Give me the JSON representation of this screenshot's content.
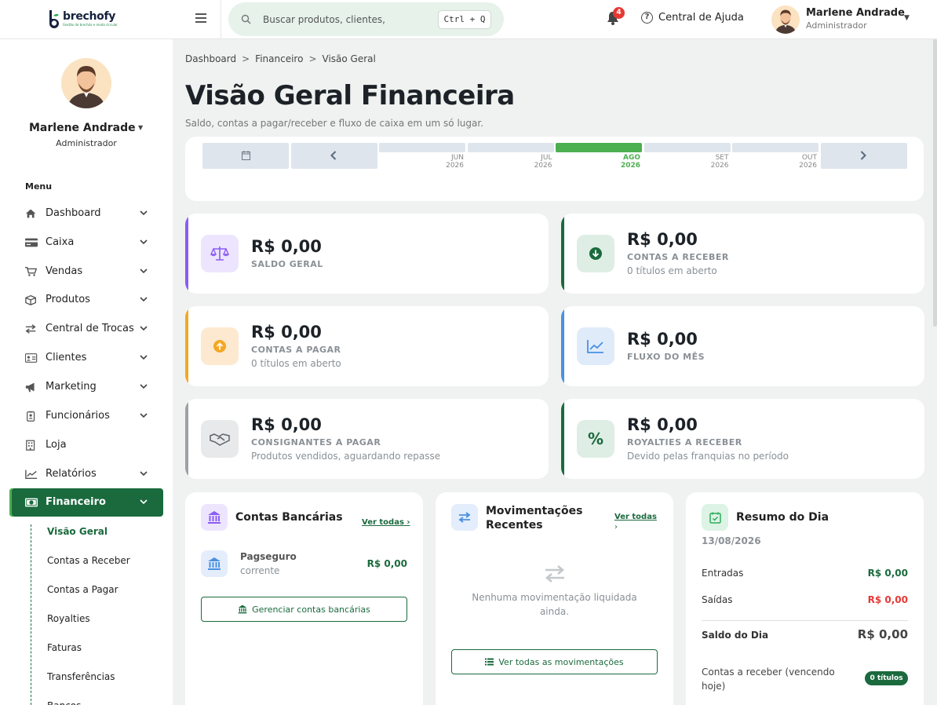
{
  "brand": {
    "name": "brechofy",
    "tagline": "Gestão de brechós e moda circular"
  },
  "header": {
    "search_placeholder": "Buscar produtos, clientes,",
    "search_shortcut": "Ctrl + Q",
    "notification_count": "4",
    "help_label": "Central de Ajuda",
    "user_name": "Marlene Andrade",
    "user_role": "Administrador"
  },
  "sidebar": {
    "user_name": "Marlene Andrade",
    "user_role": "Administrador",
    "menu_title": "Menu",
    "items": [
      {
        "label": "Dashboard",
        "icon": "home-icon",
        "expandable": true
      },
      {
        "label": "Caixa",
        "icon": "credit-card-icon",
        "expandable": true
      },
      {
        "label": "Vendas",
        "icon": "cart-icon",
        "expandable": true
      },
      {
        "label": "Produtos",
        "icon": "box-icon",
        "expandable": true
      },
      {
        "label": "Central de Trocas",
        "icon": "exchange-icon",
        "expandable": true
      },
      {
        "label": "Clientes",
        "icon": "id-card-icon",
        "expandable": true
      },
      {
        "label": "Marketing",
        "icon": "megaphone-icon",
        "expandable": true
      },
      {
        "label": "Funcionários",
        "icon": "badge-icon",
        "expandable": true
      },
      {
        "label": "Loja",
        "icon": "building-icon",
        "expandable": false
      },
      {
        "label": "Relatórios",
        "icon": "chart-line-icon",
        "expandable": true
      },
      {
        "label": "Financeiro",
        "icon": "money-icon",
        "expandable": true,
        "active": true
      }
    ],
    "submenu": [
      {
        "label": "Visão Geral",
        "active": true
      },
      {
        "label": "Contas a Receber"
      },
      {
        "label": "Contas a Pagar"
      },
      {
        "label": "Royalties"
      },
      {
        "label": "Faturas"
      },
      {
        "label": "Transferências"
      },
      {
        "label": "Bancos"
      }
    ]
  },
  "breadcrumb": [
    "Dashboard",
    "Financeiro",
    "Visão Geral"
  ],
  "page": {
    "title": "Visão Geral Financeira",
    "subtitle": "Saldo, contas a pagar/receber e fluxo de caixa em um só lugar."
  },
  "period": {
    "months": [
      {
        "label": "JUN",
        "year": "2026"
      },
      {
        "label": "JUL",
        "year": "2026"
      },
      {
        "label": "AGO",
        "year": "2026",
        "active": true
      },
      {
        "label": "SET",
        "year": "2026"
      },
      {
        "label": "OUT",
        "year": "2026"
      }
    ]
  },
  "stats": {
    "saldo": {
      "amount": "R$ 0,00",
      "label": "SALDO GERAL"
    },
    "receber": {
      "amount": "R$ 0,00",
      "label": "CONTAS A RECEBER",
      "sub": "0 títulos em aberto"
    },
    "pagar": {
      "amount": "R$ 0,00",
      "label": "CONTAS A PAGAR",
      "sub": "0 títulos em aberto"
    },
    "fluxo": {
      "amount": "R$ 0,00",
      "label": "FLUXO DO MÊS"
    },
    "consignantes": {
      "amount": "R$ 0,00",
      "label": "CONSIGNANTES A PAGAR",
      "sub": "Produtos vendidos, aguardando repasse"
    },
    "royalties": {
      "amount": "R$ 0,00",
      "label": "ROYALTIES A RECEBER",
      "sub": "Devido pelas franquias no período"
    }
  },
  "bank_card": {
    "title": "Contas Bancárias",
    "link": "Ver todas",
    "account_name": "Pagseguro",
    "account_type": "corrente",
    "account_balance": "R$ 0,00",
    "button": "Gerenciar contas bancárias"
  },
  "movements_card": {
    "title_line1": "Movimentações",
    "title_line2": "Recentes",
    "link": "Ver todas",
    "empty_line1": "Nenhuma movimentação liquidada",
    "empty_line2": "ainda.",
    "button": "Ver todas as movimentações"
  },
  "summary_card": {
    "title": "Resumo do Dia",
    "date": "13/08/2026",
    "entradas_label": "Entradas",
    "entradas_value": "R$ 0,00",
    "saidas_label": "Saídas",
    "saidas_value": "R$ 0,00",
    "saldo_label": "Saldo do Dia",
    "saldo_value": "R$ 0,00",
    "receber_hoje_line1": "Contas a receber (vencendo",
    "receber_hoje_line2": "hoje)",
    "receber_hoje_badge": "0 títulos"
  },
  "colors": {
    "primary": "#1a6a3d",
    "accent_green": "#4caf50",
    "negative": "#e53935",
    "purple": "#8b5cf6",
    "orange": "#f5a623",
    "blue": "#4a90e2",
    "gray": "#8a9096"
  }
}
